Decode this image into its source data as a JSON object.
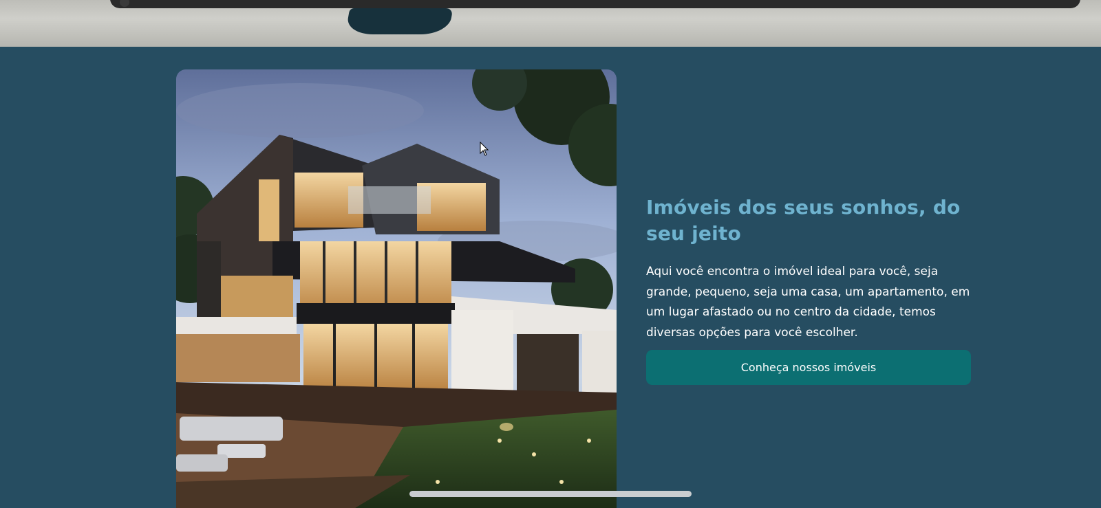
{
  "hero": {
    "headline": "Imóveis dos seus sonhos, do seu jeito",
    "description": "Aqui você encontra o imóvel ideal para você, seja grande, pequeno, seja uma casa, um apartamento, em um lugar afastado ou no centro da cidade, temos diversas opções para você escolher.",
    "cta_label": "Conheça nossos imóveis",
    "image_icon": "modern-house-photo"
  },
  "colors": {
    "background": "#264d61",
    "headline": "#6fb3cf",
    "button": "#0c6f72",
    "text": "#ffffff"
  }
}
